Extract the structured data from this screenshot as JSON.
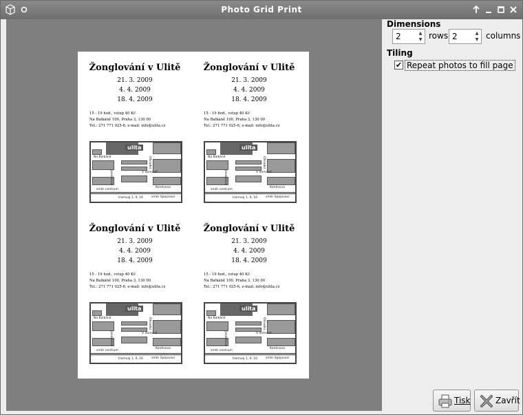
{
  "window": {
    "title": "Photo Grid Print"
  },
  "titlebar": {
    "buttons": [
      "up-icon",
      "minimize-icon",
      "maximize-icon",
      "close-icon"
    ]
  },
  "poster": {
    "title": "Žonglování v Ulitě",
    "dates": [
      "21. 3.  2009",
      "4. 4.  2009",
      "18. 4.  2009"
    ],
    "info": [
      "15 - 19 hod., vstup 40 Kč",
      "Na Balkáně 100, Praha 3, 130 00",
      "Tel.: 271 771 025-6, e-mail: info@ulita.cz"
    ],
    "map_labels": {
      "logo": "ulita",
      "street1": "Na Balkáně",
      "street2": "V domově",
      "street3": "Koněvova",
      "street_vert1": "Jeseniova",
      "street_vert2": "Ohradní",
      "direction_left": "směr centrum",
      "direction_right": "směr Spojovací",
      "tram": "tramvaj 1, 9, 16"
    }
  },
  "side": {
    "dimensions_label": "Dimensions",
    "rows_value": "2",
    "rows_label": "rows",
    "columns_value": "2",
    "columns_label": "columns",
    "tiling_label": "Tiling",
    "repeat_checkbox_checked": true,
    "repeat_label": "Repeat photos to fill page"
  },
  "buttons": {
    "print_label": "Tisk",
    "close_label": "Zavřít"
  }
}
